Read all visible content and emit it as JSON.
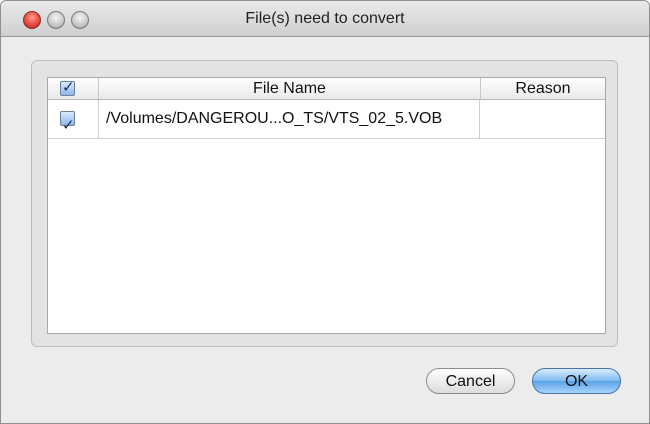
{
  "window": {
    "title": "File(s) need to convert"
  },
  "table": {
    "columns": [
      "",
      "File Name",
      "Reason"
    ],
    "header_checked": true,
    "rows": [
      {
        "checked": true,
        "file_name": "/Volumes/DANGEROU...O_TS/VTS_02_5.VOB",
        "reason": ""
      }
    ]
  },
  "buttons": {
    "cancel_label": "Cancel",
    "ok_label": "OK"
  },
  "icons": {
    "close": "close-icon",
    "minimize": "minimize-icon",
    "zoom": "zoom-icon",
    "checkmark": "checkmark-icon"
  },
  "colors": {
    "close_red": "#e5453a",
    "default_button_blue": "#5aa2e6"
  }
}
